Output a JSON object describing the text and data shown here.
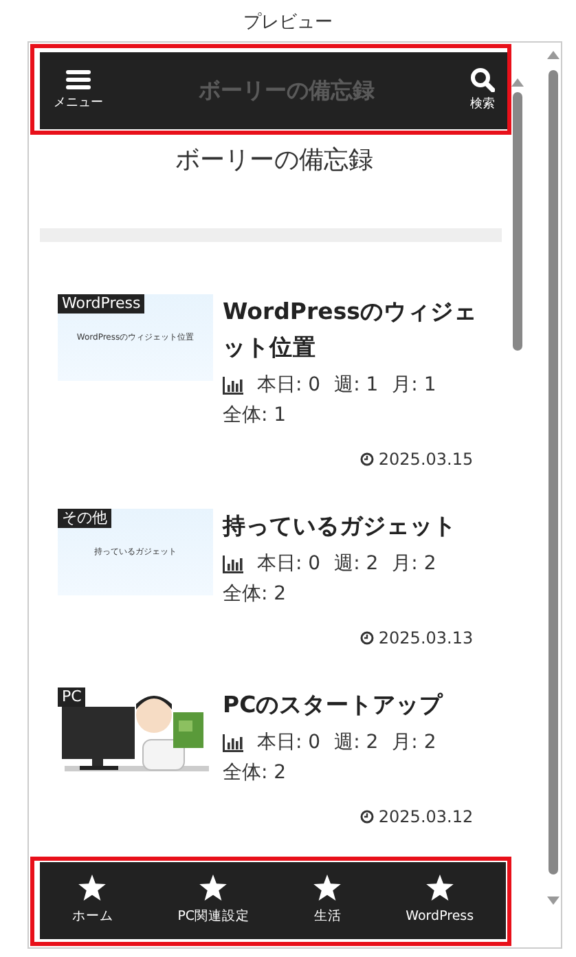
{
  "panel_title": "プレビュー",
  "header": {
    "menu_label": "メニュー",
    "site_title": "ボーリーの備忘録",
    "search_label": "検索"
  },
  "site_title": "ボーリーの備忘録",
  "posts": [
    {
      "category": "WordPress",
      "thumbnail_text": "WordPressのウィジェット位置",
      "kind": "text",
      "title": "WordPressのウィジェット位置",
      "stats": [
        "本日: 0",
        "週: 1",
        "月: 1",
        "全体: 1"
      ],
      "date": "2025.03.15"
    },
    {
      "category": "その他",
      "thumbnail_text": "持っているガジェット",
      "kind": "text",
      "title": "持っているガジェット",
      "stats": [
        "本日: 0",
        "週: 2",
        "月: 2",
        "全体: 2"
      ],
      "date": "2025.03.13"
    },
    {
      "category": "PC",
      "kind": "picture",
      "title": "PCのスタートアップ",
      "stats": [
        "本日: 0",
        "週: 2",
        "月: 2",
        "全体: 2"
      ],
      "date": "2025.03.12"
    }
  ],
  "footer_nav": [
    {
      "label": "ホーム"
    },
    {
      "label": "PC関連設定"
    },
    {
      "label": "生活"
    },
    {
      "label": "WordPress"
    }
  ]
}
